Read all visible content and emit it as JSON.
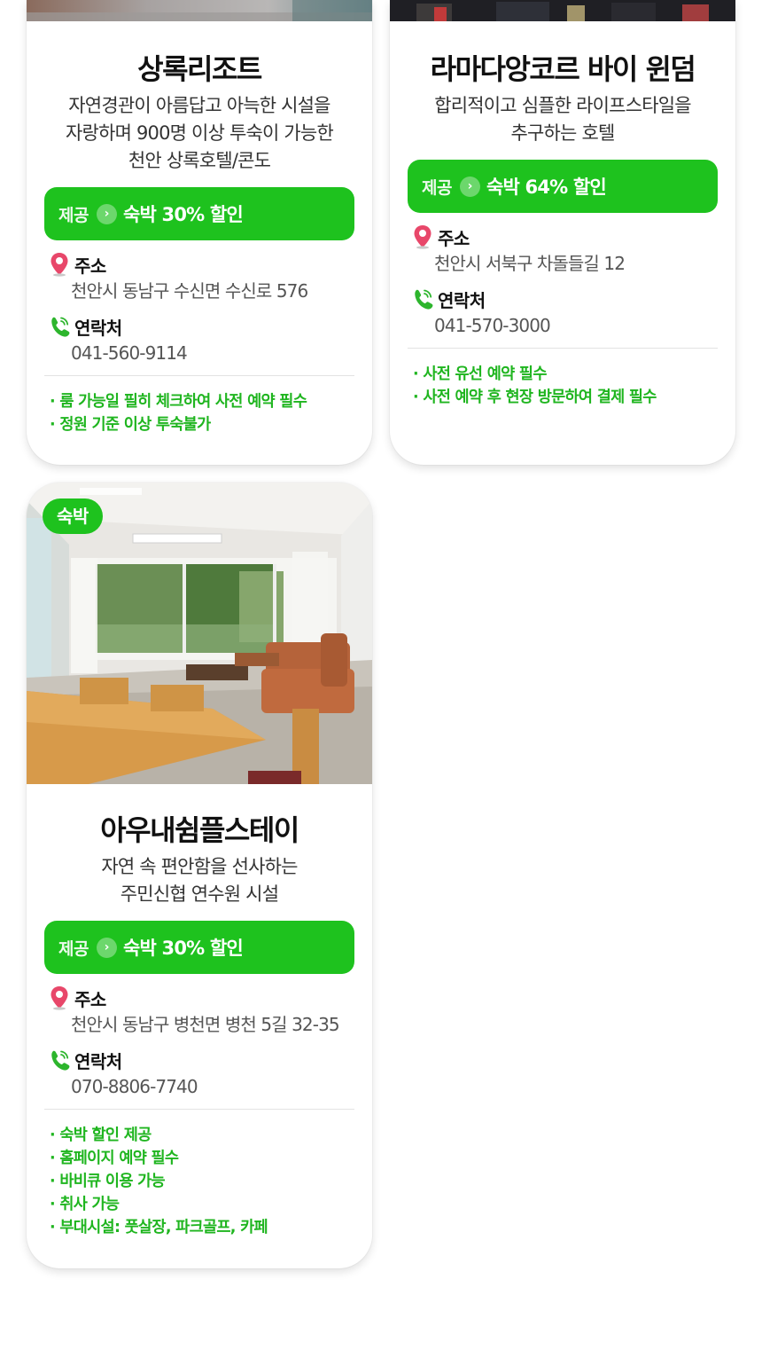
{
  "cards": [
    {
      "title": "상록리조트",
      "desc_lines": [
        "자연경관이 아름답고 아늑한 시설을",
        "자랑하며 900명 이상 투숙이 가능한",
        "천안 상록호텔/콘도"
      ],
      "offer_label": "제공",
      "offer_text": "숙박 30% 할인",
      "address_label": "주소",
      "address": "천안시 동남구 수신면 수신로 576",
      "contact_label": "연락처",
      "phone": "041-560-9114",
      "notes": [
        "· 룸 가능일 필히 체크하여 사전 예약 필수",
        "· 정원 기준 이상 투숙불가"
      ]
    },
    {
      "title": "라마다앙코르 바이 윈덤",
      "desc_lines": [
        "합리적이고 심플한 라이프스타일을",
        "추구하는 호텔"
      ],
      "offer_label": "제공",
      "offer_text": "숙박 64% 할인",
      "address_label": "주소",
      "address": "천안시 서북구 차돌들길 12",
      "contact_label": "연락처",
      "phone": "041-570-3000",
      "notes": [
        "· 사전 유선 예약 필수",
        "· 사전 예약 후 현장 방문하여 결제 필수"
      ]
    },
    {
      "badge": "숙박",
      "title": "아우내쉼플스테이",
      "desc_lines": [
        "자연 속 편안함을 선사하는",
        "주민신협 연수원 시설"
      ],
      "offer_label": "제공",
      "offer_text": "숙박 30% 할인",
      "address_label": "주소",
      "address": "천안시 동남구 병천면 병천 5길 32-35",
      "contact_label": "연락처",
      "phone": "070-8806-7740",
      "notes": [
        "· 숙박 할인 제공",
        "· 홈페이지 예약 필수",
        "· 바비큐 이용 가능",
        "· 취사 가능",
        "· 부대시설: 풋살장, 파크골프, 카페"
      ]
    }
  ],
  "icons": {
    "address": "map-pin-icon",
    "contact": "phone-icon",
    "offer": "chevron-right-circle-icon"
  },
  "colors": {
    "accent_green": "#1ec21e",
    "note_green": "#1fb51f",
    "pin_red": "#e8476a",
    "phone_green": "#2db52d"
  }
}
